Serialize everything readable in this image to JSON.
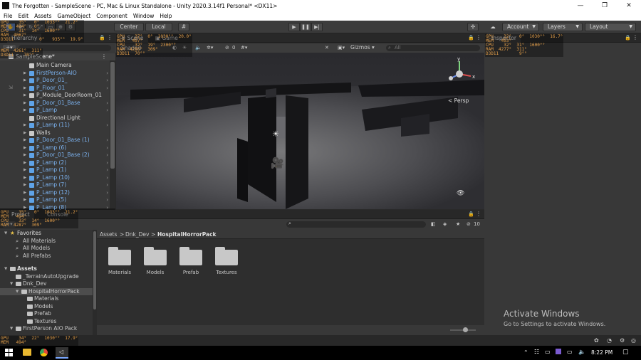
{
  "window": {
    "title": "The Forgotten - SampleScene - PC, Mac & Linux Standalone - Unity 2020.3.14f1 Personal* <DX11>",
    "minimize": "—",
    "maximize": "❐",
    "close": "✕"
  },
  "menu": [
    "File",
    "Edit",
    "Assets",
    "GameObject",
    "Component",
    "Window",
    "Help"
  ],
  "toolbar": {
    "pivot_label": "Center",
    "space_label": "Local",
    "account_label": "Account",
    "layers_label": "Layers",
    "layout_label": "Layout"
  },
  "hierarchy": {
    "tab_label": "Hierarchy",
    "scene_name": "SampleScene*",
    "items": [
      {
        "label": "Main Camera",
        "type": "object",
        "arrow": false,
        "chev": false
      },
      {
        "label": "FirstPerson-AIO",
        "type": "prefab",
        "arrow": true,
        "chev": true
      },
      {
        "label": "P_Door_01_",
        "type": "prefab",
        "arrow": true,
        "chev": true
      },
      {
        "label": "P_Floor_01",
        "type": "prefab",
        "arrow": true,
        "chev": true
      },
      {
        "label": "P_Module_DoorRoom_01",
        "type": "object",
        "arrow": true,
        "chev": false
      },
      {
        "label": "P_Door_01_Base",
        "type": "prefab",
        "arrow": true,
        "chev": true
      },
      {
        "label": "P_Lamp",
        "type": "prefab",
        "arrow": true,
        "chev": true
      },
      {
        "label": "Directional Light",
        "type": "object",
        "arrow": false,
        "chev": false
      },
      {
        "label": "P_Lamp (11)",
        "type": "prefab",
        "arrow": true,
        "chev": true
      },
      {
        "label": "Walls",
        "type": "object",
        "arrow": true,
        "chev": false
      },
      {
        "label": "P_Door_01_Base (1)",
        "type": "prefab",
        "arrow": true,
        "chev": true
      },
      {
        "label": "P_Lamp (6)",
        "type": "prefab",
        "arrow": true,
        "chev": true
      },
      {
        "label": "P_Door_01_Base (2)",
        "type": "prefab",
        "arrow": true,
        "chev": true
      },
      {
        "label": "P_Lamp (2)",
        "type": "prefab",
        "arrow": true,
        "chev": true
      },
      {
        "label": "P_Lamp (1)",
        "type": "prefab",
        "arrow": true,
        "chev": true
      },
      {
        "label": "P_Lamp (10)",
        "type": "prefab",
        "arrow": true,
        "chev": true
      },
      {
        "label": "P_Lamp (7)",
        "type": "prefab",
        "arrow": true,
        "chev": true
      },
      {
        "label": "P_Lamp (12)",
        "type": "prefab",
        "arrow": true,
        "chev": true
      },
      {
        "label": "P_Lamp (5)",
        "type": "prefab",
        "arrow": true,
        "chev": true
      },
      {
        "label": "P_Lamp (8)",
        "type": "prefab",
        "arrow": true,
        "chev": true
      }
    ]
  },
  "scene_view": {
    "tab_scene": "Scene",
    "tab_game": "Game",
    "mode_label": "Shaded",
    "layer_count": "0",
    "gizmos_label": "Gizmos",
    "search_placeholder": "All",
    "persp_label": "< Persp",
    "axis_y": "y",
    "axis_x": "x"
  },
  "inspector": {
    "tab_label": "Inspector"
  },
  "project": {
    "tab_project": "Project",
    "tab_console": "Console",
    "favorites_label": "Favorites",
    "favorites": [
      "All Materials",
      "All Models",
      "All Prefabs"
    ],
    "assets_label": "Assets",
    "tree": [
      {
        "label": "_TerrainAutoUpgrade",
        "indent": 1,
        "arrow": false
      },
      {
        "label": "Dnk_Dev",
        "indent": 1,
        "arrow": true
      },
      {
        "label": "HospitalHorrorPack",
        "indent": 2,
        "arrow": true,
        "selected": true
      },
      {
        "label": "Materials",
        "indent": 3,
        "arrow": false
      },
      {
        "label": "Models",
        "indent": 3,
        "arrow": false
      },
      {
        "label": "Prefab",
        "indent": 3,
        "arrow": false
      },
      {
        "label": "Textures",
        "indent": 3,
        "arrow": false
      },
      {
        "label": "FirstPerson AIO Pack",
        "indent": 1,
        "arrow": true
      }
    ],
    "breadcrumb": [
      "Assets",
      "Dnk_Dev",
      "HospitalHorrorPack"
    ],
    "folders": [
      "Materials",
      "Models",
      "Prefab",
      "Textures"
    ],
    "hidden_count": "10"
  },
  "stats_overlays": {
    "top_left": "GPU    35°   0°  1033°°  21.2°\nMEM   494°   0°             \nCPU    31°  14°  1600°°      \nRAM  4067°    \nD3D11          0°   935°°  19.9°",
    "scene_top": "GPU    37°  0°  1030°°  20.0°\nMEM   497°             \nCPU    32°  19°  2300°°      \nRAM  4286°  309°\nD3D11  70°°",
    "hier_mid": "MEM  4261°  311°\nD3D11    70°°",
    "inspector_top": "GPU    32°   0°  1030°°  16.7°\nMEM   493°            \nCPU    32°  31°  1600°°      \nRAM  4277°  311°\nD3D11        9°°",
    "project_top": "GPU    35°   0°  1033°°  21.2°\nMEM   494°             \nCPU    33°  14°  1600°°      \nRAM  4287°  309°",
    "bottom_left": "GPU    34°  22°  1030°°  17.9°\nMEM   494°"
  },
  "activate_windows": {
    "title": "Activate Windows",
    "subtitle": "Go to Settings to activate Windows."
  },
  "taskbar": {
    "time": "8:22 PM"
  }
}
